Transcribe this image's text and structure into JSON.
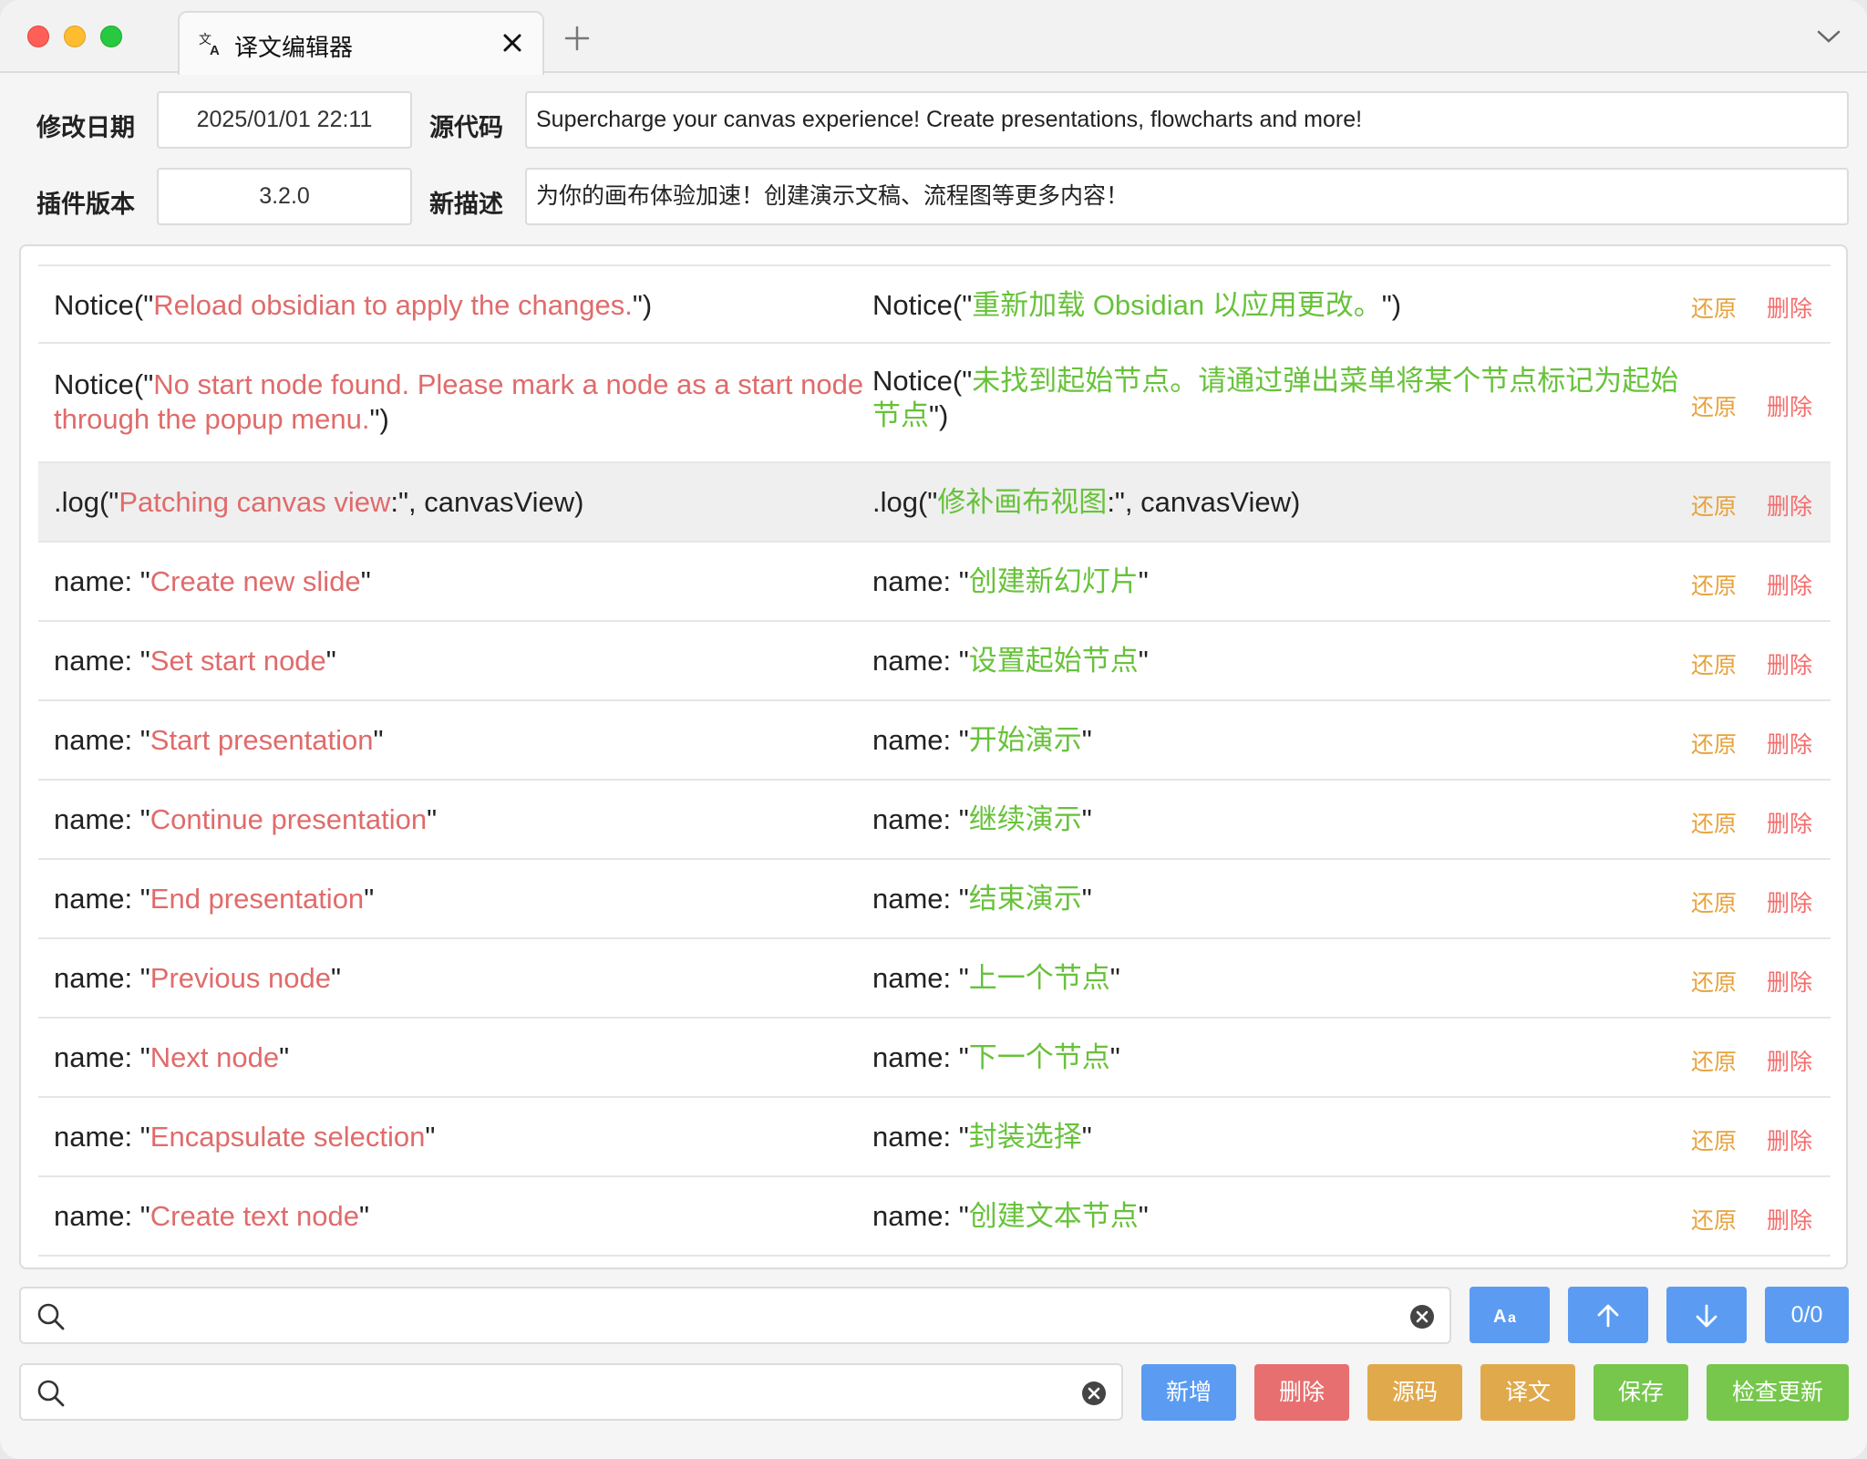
{
  "window": {
    "tab_title": "译文编辑器",
    "tab_icon": "translate-icon"
  },
  "meta": {
    "modified_label": "修改日期",
    "modified_value": "2025/01/01 22:11",
    "plugin_version_label": "插件版本",
    "plugin_version_value": "3.2.0",
    "source_label": "源代码",
    "source_value": "Supercharge your canvas experience! Create presentations, flowcharts and more!",
    "new_desc_label": "新描述",
    "new_desc_value": "为你的画布体验加速！创建演示文稿、流程图等更多内容！"
  },
  "actions": {
    "restore": "还原",
    "delete": "删除"
  },
  "rows": [
    {
      "src_prefix": "Notice(\"",
      "src_text": "Reload obsidian to apply the changes.",
      "src_suffix": "\")",
      "dst_prefix": "Notice(\"",
      "dst_text": "重新加载 Obsidian 以应用更改。",
      "dst_suffix": "\")"
    },
    {
      "src_prefix": "Notice(\"",
      "src_text": "No start node found. Please mark a node as a start node through the popup menu.",
      "src_suffix": "\")",
      "dst_prefix": "Notice(\"",
      "dst_text": "未找到起始节点。请通过弹出菜单将某个节点标记为起始节点",
      "dst_suffix": "\")"
    },
    {
      "src_prefix": ".log(\"",
      "src_text": "Patching canvas view",
      "src_suffix": ":\", canvasView)",
      "dst_prefix": ".log(\"",
      "dst_text": "修补画布视图",
      "dst_suffix": ":\", canvasView)"
    },
    {
      "src_prefix": "name: \"",
      "src_text": "Create new slide",
      "src_suffix": "\"",
      "dst_prefix": "name: \"",
      "dst_text": "创建新幻灯片",
      "dst_suffix": "\""
    },
    {
      "src_prefix": "name: \"",
      "src_text": "Set start node",
      "src_suffix": "\"",
      "dst_prefix": "name: \"",
      "dst_text": "设置起始节点",
      "dst_suffix": "\""
    },
    {
      "src_prefix": "name: \"",
      "src_text": "Start presentation",
      "src_suffix": "\"",
      "dst_prefix": "name: \"",
      "dst_text": "开始演示",
      "dst_suffix": "\""
    },
    {
      "src_prefix": "name: \"",
      "src_text": "Continue presentation",
      "src_suffix": "\"",
      "dst_prefix": "name: \"",
      "dst_text": "继续演示",
      "dst_suffix": "\""
    },
    {
      "src_prefix": "name: \"",
      "src_text": "End presentation",
      "src_suffix": "\"",
      "dst_prefix": "name: \"",
      "dst_text": "结束演示",
      "dst_suffix": "\""
    },
    {
      "src_prefix": "name: \"",
      "src_text": "Previous node",
      "src_suffix": "\"",
      "dst_prefix": "name: \"",
      "dst_text": "上一个节点",
      "dst_suffix": "\""
    },
    {
      "src_prefix": "name: \"",
      "src_text": "Next node",
      "src_suffix": "\"",
      "dst_prefix": "name: \"",
      "dst_text": "下一个节点",
      "dst_suffix": "\""
    },
    {
      "src_prefix": "name: \"",
      "src_text": "Encapsulate selection",
      "src_suffix": "\"",
      "dst_prefix": "name: \"",
      "dst_text": "封装选择",
      "dst_suffix": "\""
    },
    {
      "src_prefix": "name: \"",
      "src_text": "Create text node",
      "src_suffix": "\"",
      "dst_prefix": "name: \"",
      "dst_text": "创建文本节点",
      "dst_suffix": "\""
    }
  ],
  "find_bar": {
    "value": "",
    "match_case_icon": "match-case-icon",
    "prev_icon": "arrow-up-icon",
    "next_icon": "arrow-down-icon",
    "match_count": "0/0"
  },
  "filter_bar": {
    "value": "",
    "buttons": {
      "add": "新增",
      "delete": "删除",
      "source": "源码",
      "translation": "译文",
      "save": "保存",
      "check_update": "检查更新"
    }
  },
  "colors": {
    "source_highlight": "#e06b6b",
    "translation_highlight": "#67c23a",
    "restore_action": "#e6a23c",
    "delete_action": "#f56c6c",
    "primary": "#5b9cf2"
  }
}
